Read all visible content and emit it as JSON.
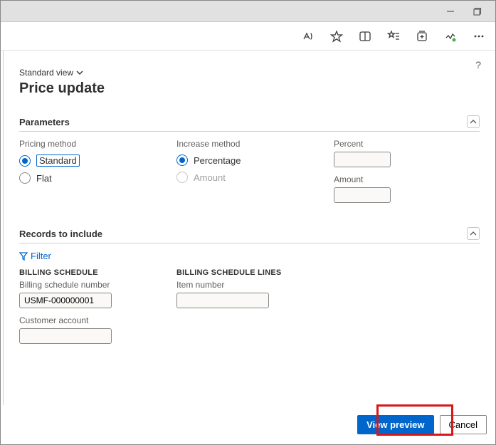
{
  "header": {
    "view_label": "Standard view",
    "page_title": "Price update",
    "help": "?"
  },
  "sections": {
    "parameters": {
      "title": "Parameters",
      "pricing_method_label": "Pricing method",
      "pricing_standard": "Standard",
      "pricing_flat": "Flat",
      "increase_method_label": "Increase method",
      "increase_percentage": "Percentage",
      "increase_amount": "Amount",
      "percent_label": "Percent",
      "percent_value": "",
      "amount_label": "Amount",
      "amount_value": ""
    },
    "records": {
      "title": "Records to include",
      "filter_label": "Filter",
      "billing_schedule": {
        "heading": "BILLING SCHEDULE",
        "number_label": "Billing schedule number",
        "number_value": "USMF-000000001",
        "customer_label": "Customer account",
        "customer_value": ""
      },
      "billing_schedule_lines": {
        "heading": "BILLING SCHEDULE LINES",
        "item_label": "Item number",
        "item_value": ""
      }
    }
  },
  "footer": {
    "primary": "View preview",
    "cancel": "Cancel"
  }
}
